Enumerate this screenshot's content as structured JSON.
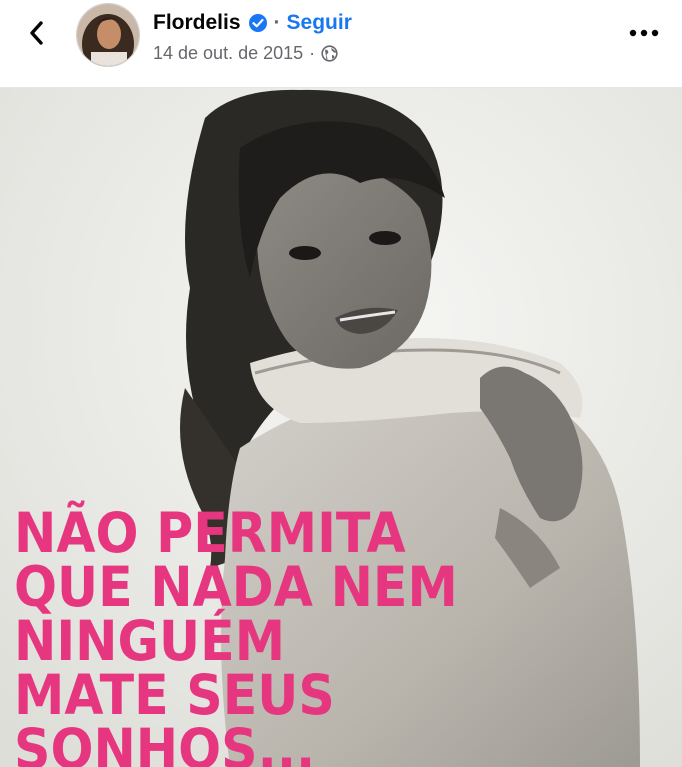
{
  "post": {
    "author": "Flordelis",
    "separator": "·",
    "follow_label": "Seguir",
    "date": "14 de out. de 2015",
    "meta_separator": "·",
    "verified": true,
    "privacy": "public"
  },
  "icons": {
    "back": "chevron-left-icon",
    "verified": "verified-badge-icon",
    "privacy": "globe-icon",
    "more": "more-horizontal-icon"
  },
  "colors": {
    "follow_link": "#1877f2",
    "verified_badge": "#1877f2",
    "quote_text": "#e6367f",
    "meta_text": "#65676b"
  },
  "image": {
    "quote_lines": [
      "NÃO PERMITA",
      "QUE NADA NEM",
      "NINGUÉM",
      "MATE SEUS",
      "SONHOS..."
    ]
  }
}
